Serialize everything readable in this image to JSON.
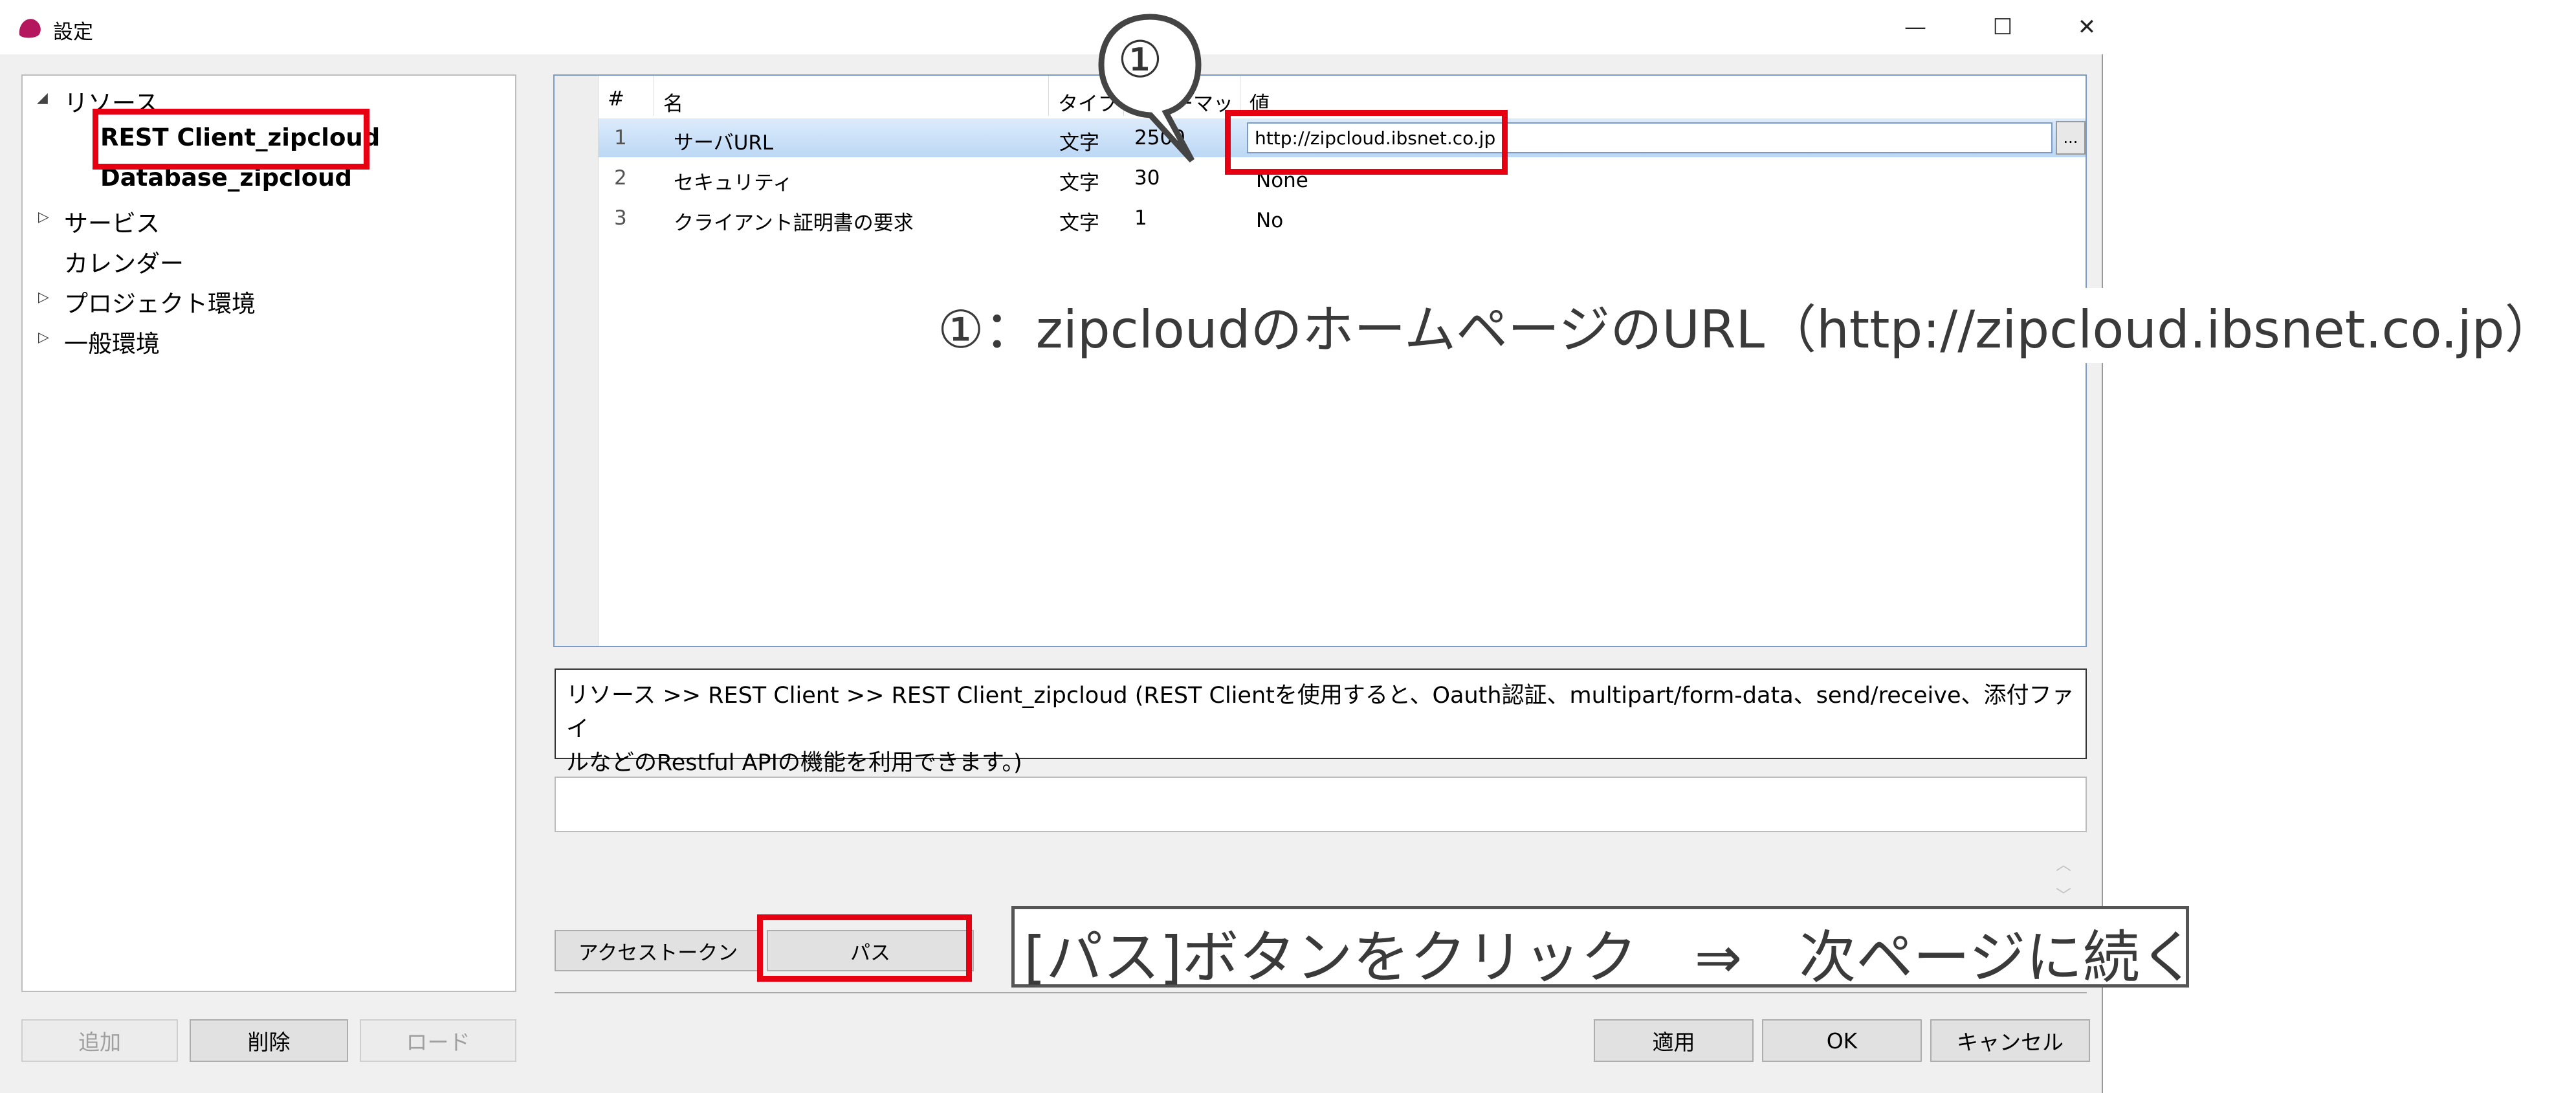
{
  "window": {
    "title": "設定",
    "controls": {
      "minimize": "—",
      "maximize": "☐",
      "close": "✕"
    }
  },
  "tree": {
    "resources": "リソース",
    "rest_client": "REST Client_zipcloud",
    "database": "Database_zipcloud",
    "service": "サービス",
    "calendar": "カレンダー",
    "project_env": "プロジェクト環境",
    "general_env": "一般環境"
  },
  "left_buttons": {
    "add": "追加",
    "delete": "削除",
    "load": "ロード"
  },
  "grid": {
    "columns": [
      "#",
      "名",
      "タイプ",
      "フォーマット",
      "値"
    ],
    "rows": [
      {
        "num": "1",
        "name": "サーバURL",
        "type": "文字",
        "format": "2500",
        "value": "http://zipcloud.ibsnet.co.jp"
      },
      {
        "num": "2",
        "name": "セキュリティ",
        "type": "文字",
        "format": "30",
        "value": "None"
      },
      {
        "num": "3",
        "name": "クライアント証明書の要求",
        "type": "文字",
        "format": "1",
        "value": "No"
      }
    ],
    "ellipsis_label": "..."
  },
  "description": {
    "line1": "リソース >> REST Client >> REST Client_zipcloud (REST Clientを使用すると、Oauth認証、multipart/form-data、send/receive、添付ファイ",
    "line2": "ルなどのRestful APIの機能を利用できます。)"
  },
  "tabs": {
    "access_token": "アクセストークン",
    "path": "パス"
  },
  "right_buttons": {
    "apply": "適用",
    "ok": "OK",
    "cancel": "キャンセル"
  },
  "annotations": {
    "circle_one": "①",
    "note_url": "①：zipcloudのホームページのURL（http://zipcloud.ibsnet.co.jp）",
    "note_path": "[パス]ボタンをクリック　⇒　次ページに続く"
  },
  "colors": {
    "highlight_red": "#e60012",
    "selected_row": "#bcd8f5",
    "accent_blue": "#7a9cc6"
  }
}
